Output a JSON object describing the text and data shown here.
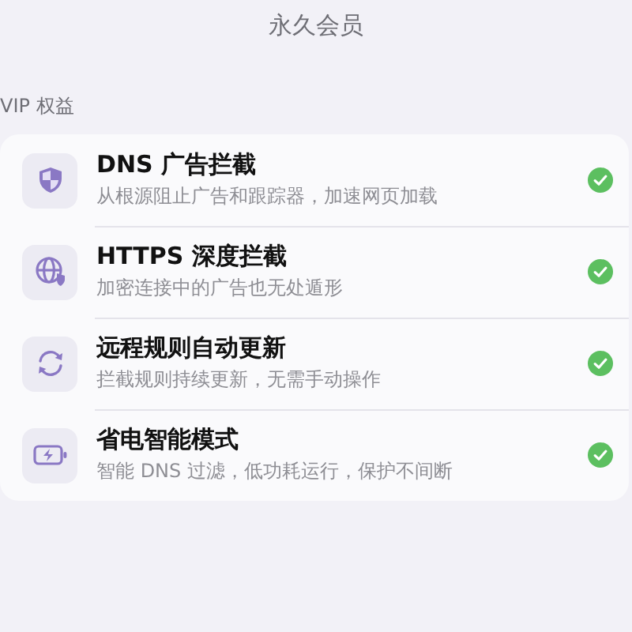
{
  "header": {
    "title": "永久会员"
  },
  "section": {
    "label": "VIP 权益"
  },
  "benefits": [
    {
      "title": "DNS 广告拦截",
      "subtitle": "从根源阻止广告和跟踪器，加速网页加载",
      "checked": true
    },
    {
      "title": "HTTPS 深度拦截",
      "subtitle": "加密连接中的广告也无处遁形",
      "checked": true
    },
    {
      "title": "远程规则自动更新",
      "subtitle": "拦截规则持续更新，无需手动操作",
      "checked": true
    },
    {
      "title": "省电智能模式",
      "subtitle": "智能 DNS 过滤，低功耗运行，保护不间断",
      "checked": true
    }
  ]
}
